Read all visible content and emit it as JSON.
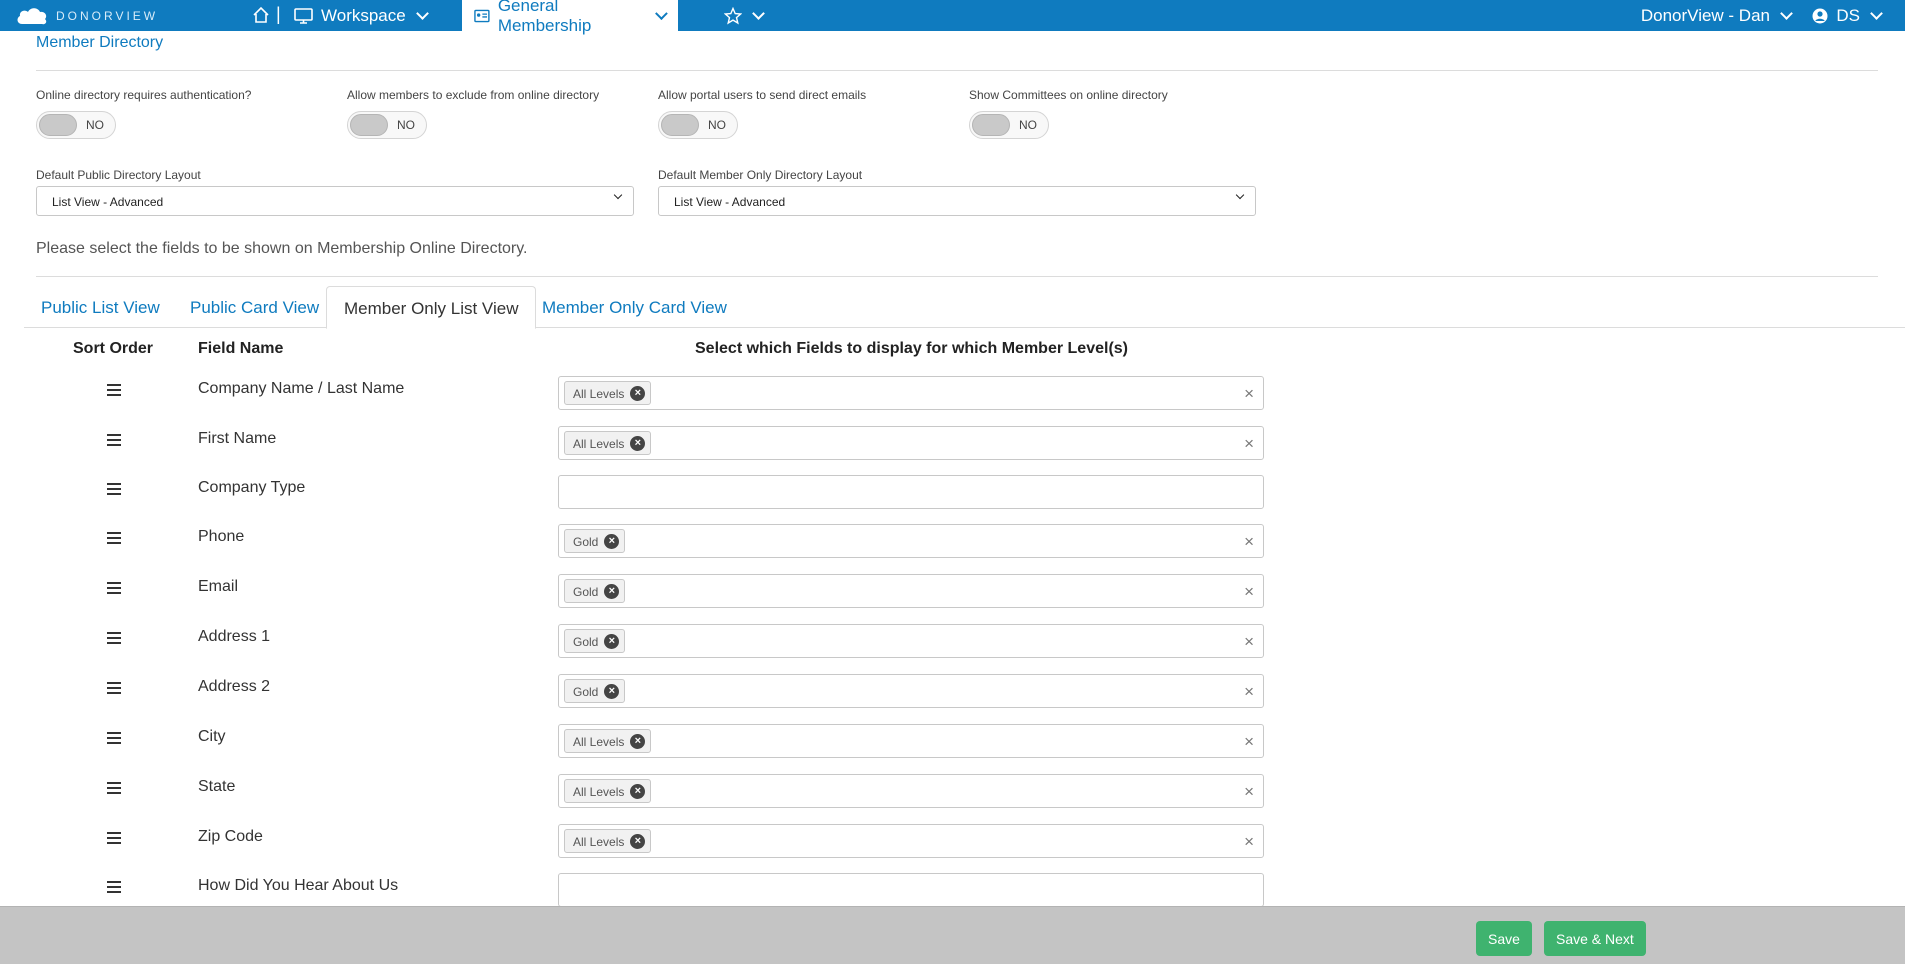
{
  "nav": {
    "logo_text": "DONORVIEW",
    "workspace": "Workspace",
    "module": "General Membership",
    "user": "DonorView - Dan",
    "initials": "DS"
  },
  "section": {
    "title": "Member Directory"
  },
  "toggles": [
    {
      "label": "Online directory requires authentication?",
      "state": "NO"
    },
    {
      "label": "Allow members to exclude from online directory",
      "state": "NO"
    },
    {
      "label": "Allow portal users to send direct emails",
      "state": "NO"
    },
    {
      "label": "Show Committees on online directory",
      "state": "NO"
    }
  ],
  "layouts": {
    "public_label": "Default Public Directory Layout",
    "public_value": "List View - Advanced",
    "member_label": "Default Member Only Directory Layout",
    "member_value": "List View - Advanced"
  },
  "info_text": "Please select the fields to be shown on Membership Online Directory.",
  "tabs": [
    "Public List View",
    "Public Card View",
    "Member Only List View",
    "Member Only Card View"
  ],
  "active_tab": "Member Only List View",
  "table": {
    "headers": {
      "sort": "Sort Order",
      "field": "Field Name",
      "levels": "Select which Fields to display for which Member Level(s)"
    },
    "rows": [
      {
        "name": "Company Name / Last Name",
        "level": "All Levels"
      },
      {
        "name": "First Name",
        "level": "All Levels"
      },
      {
        "name": "Company Type",
        "level": ""
      },
      {
        "name": "Phone",
        "level": "Gold"
      },
      {
        "name": "Email",
        "level": "Gold"
      },
      {
        "name": "Address 1",
        "level": "Gold"
      },
      {
        "name": "Address 2",
        "level": "Gold"
      },
      {
        "name": "City",
        "level": "All Levels"
      },
      {
        "name": "State",
        "level": "All Levels"
      },
      {
        "name": "Zip Code",
        "level": "All Levels"
      },
      {
        "name": "How Did You Hear About Us",
        "level": ""
      }
    ]
  },
  "footer": {
    "save": "Save",
    "save_next": "Save & Next"
  },
  "colors": {
    "brand": "#0f7bbf",
    "button": "#3fb36f"
  }
}
